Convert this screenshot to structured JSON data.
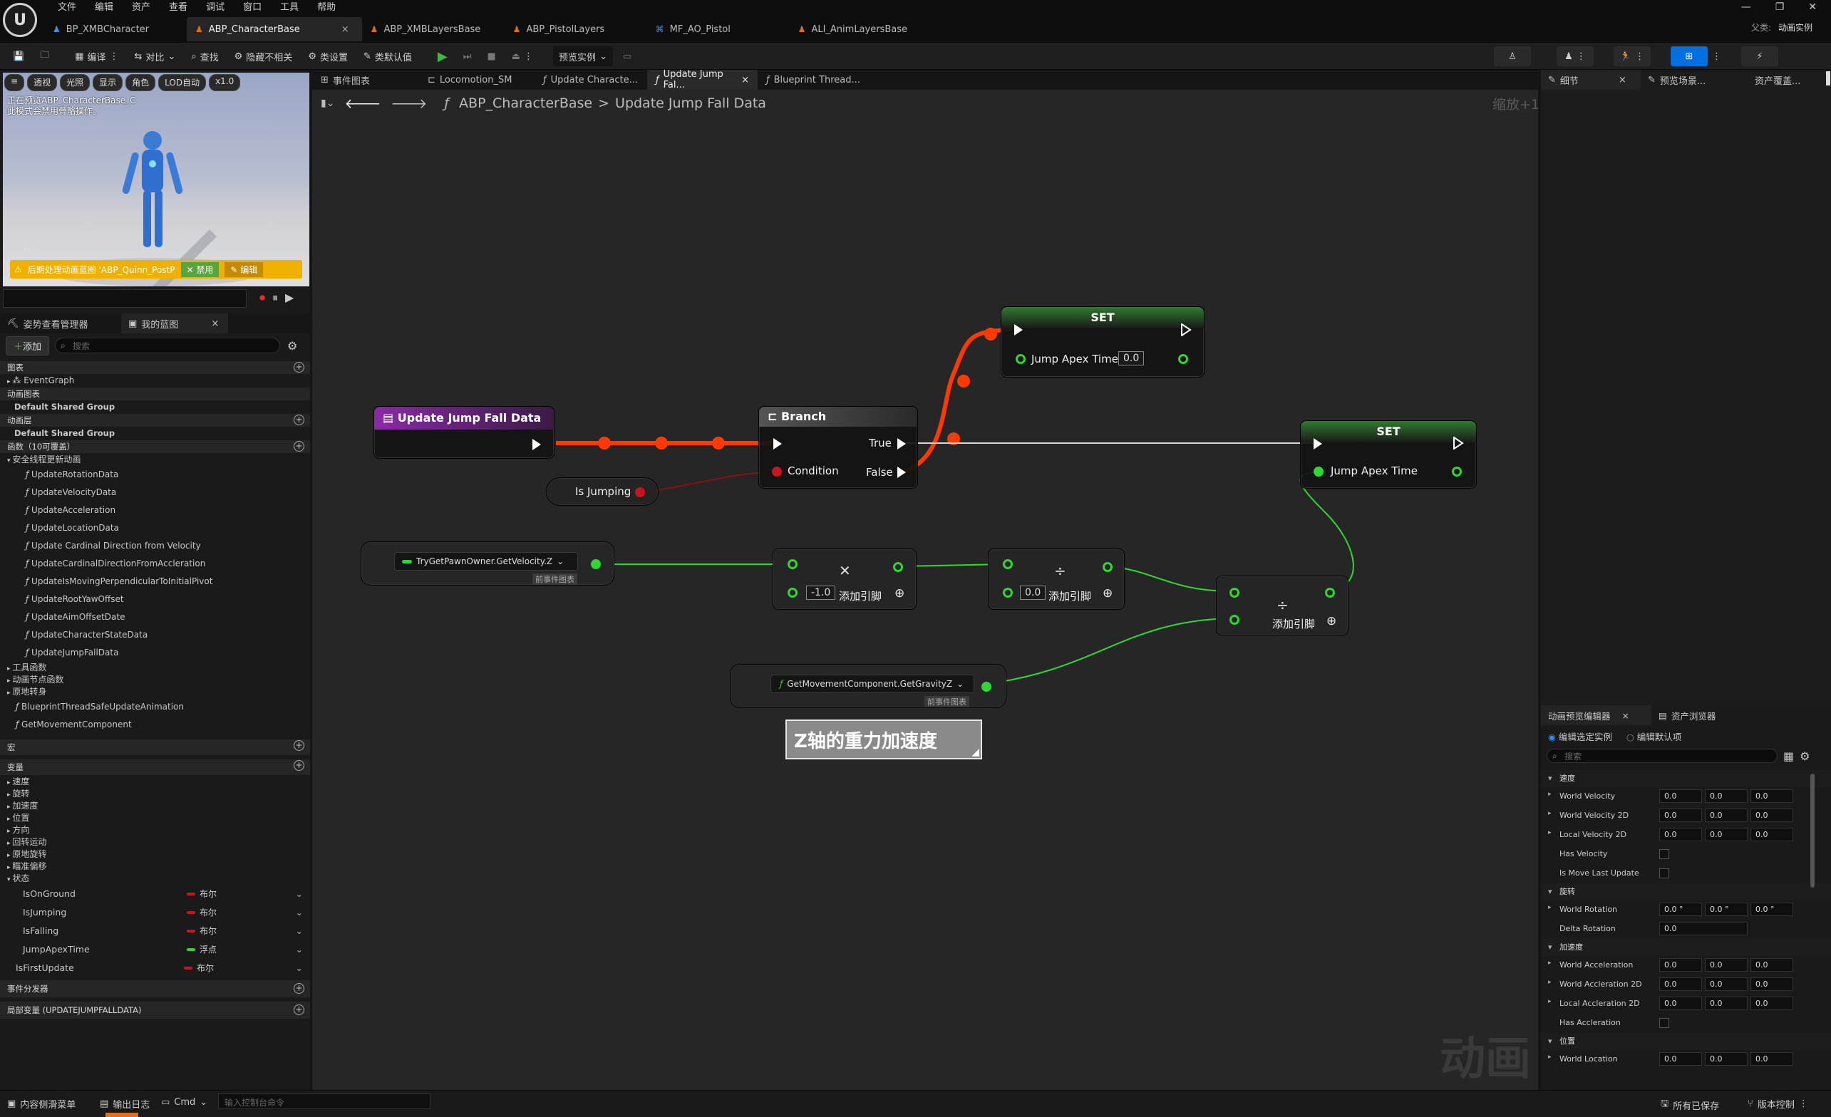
{
  "menu": [
    "文件",
    "编辑",
    "资产",
    "查看",
    "调试",
    "窗口",
    "工具",
    "帮助"
  ],
  "tabs": [
    {
      "label": "BP_XMBCharacter",
      "active": false
    },
    {
      "label": "ABP_CharacterBase",
      "active": true
    },
    {
      "label": "ABP_XMBLayersBase",
      "active": false
    },
    {
      "label": "ABP_PistolLayers",
      "active": false
    },
    {
      "label": "MF_AO_Pistol",
      "active": false
    },
    {
      "label": "ALI_AnimLayersBase",
      "active": false
    }
  ],
  "parent": {
    "label": "父类:",
    "value": "动画实例"
  },
  "toolbar": {
    "compile": "编译",
    "diff": "对比",
    "find": "查找",
    "hide": "隐藏不相关",
    "class_settings": "类设置",
    "class_defaults": "类默认值",
    "preview": "预览实例"
  },
  "viewport": {
    "buttons": [
      "透视",
      "光照",
      "显示",
      "角色",
      "LOD自动",
      "x1.0"
    ],
    "info_line1": "正在预览ABP_CharacterBase_C",
    "info_line2": "此模式会禁用骨骼操作。",
    "warning": "后期处理动画蓝图 'ABP_Quinn_PostP",
    "warn_disable": "禁用",
    "warn_edit": "编辑"
  },
  "left_tabs": {
    "skeleton": "姿势查看管理器",
    "myblueprint": "我的蓝图"
  },
  "add_label": "添加",
  "search_placeholder": "搜索",
  "tree": {
    "graphs": "图表",
    "event_graph": "EventGraph",
    "anim_graphs": "动画图表",
    "default_shared1": "Default Shared Group",
    "anim_layers": "动画层",
    "default_shared2": "Default Shared Group",
    "functions": "函数（10可覆盖）",
    "thread_safe": "安全线程更新动画",
    "function_items": [
      "UpdateRotationData",
      "UpdateVelocityData",
      "UpdateAcceleration",
      "UpdateLocationData",
      "Update Cardinal Direction from Velocity",
      "UpdateCardinalDirectionFromAccleration",
      "UpdateIsMovingPerpendicularToInitialPivot",
      "UpdateRootYawOffset",
      "UpdateAimOffsetDate",
      "UpdateCharacterStateData",
      "UpdateJumpFallData"
    ],
    "tool_funcs": "工具函数",
    "anim_node_funcs": "动画节点函数",
    "turn_in_place": "原地转身",
    "bp_thread": "BlueprintThreadSafeUpdateAnimation",
    "get_move": "GetMovementComponent",
    "macros": "宏",
    "variables": "变量",
    "var_groups": [
      "速度",
      "旋转",
      "加速度",
      "位置",
      "方向",
      "回转运动",
      "原地旋转",
      "瞄准偏移",
      "状态"
    ],
    "state_vars": [
      {
        "name": "IsOnGround",
        "type": "布尔",
        "color": "#c8141e"
      },
      {
        "name": "IsJumping",
        "type": "布尔",
        "color": "#c8141e"
      },
      {
        "name": "IsFalling",
        "type": "布尔",
        "color": "#c8141e"
      },
      {
        "name": "JumpApexTime",
        "type": "浮点",
        "color": "#2fd82f"
      }
    ],
    "first_update": {
      "name": "IsFirstUpdate",
      "type": "布尔",
      "color": "#c8141e"
    },
    "dispatchers": "事件分发器",
    "locals": "局部变量 (UPDATEJUMPFALLDATA)"
  },
  "graph_tabs": [
    {
      "label": "事件图表",
      "active": false
    },
    {
      "label": "Locomotion_SM",
      "active": false
    },
    {
      "label": "Update Characte...",
      "active": false
    },
    {
      "label": "Update Jump Fal...",
      "active": true
    },
    {
      "label": "Blueprint Thread...",
      "active": false
    }
  ],
  "breadcrumb": {
    "root": "ABP_CharacterBase",
    "sep": ">",
    "leaf": "Update Jump Fall Data"
  },
  "zoom": "缩放+1",
  "watermark": "动画",
  "nodes": {
    "entry": "Update Jump Fall Data",
    "branch": "Branch",
    "true": "True",
    "false": "False",
    "condition": "Condition",
    "isjumping": "Is Jumping",
    "set1": "SET",
    "set1_pin": "Jump Apex Time",
    "set1_val": "0.0",
    "set2": "SET",
    "set2_pin": "Jump Apex Time",
    "velocity": "TryGetPawnOwner.GetVelocity.Z",
    "velocity_tag": "前事件图表",
    "gravity": "GetMovementComponent.GetGravityZ",
    "gravity_tag": "前事件图表",
    "mul_val": "-1.0",
    "mul_add": "添加引脚",
    "div1_val": "0.0",
    "div1_add": "添加引脚",
    "div2_add": "添加引脚",
    "comment": "Z轴的重力加速度"
  },
  "right_tabs": {
    "details": "细节",
    "preview": "预览场景...",
    "asset": "资产覆盖..."
  },
  "anim_preview": {
    "tab1": "动画预览编辑器",
    "tab2": "资产浏览器",
    "radio1": "编辑选定实例",
    "radio2": "编辑默认项",
    "search": "搜索",
    "cat_velocity": "速度",
    "cat_rotation": "旋转",
    "cat_accel": "加速度",
    "cat_location": "位置",
    "props": {
      "world_velocity": {
        "name": "World Velocity",
        "vals": [
          "0.0",
          "0.0",
          "0.0"
        ]
      },
      "world_velocity_2d": {
        "name": "World Velocity 2D",
        "vals": [
          "0.0",
          "0.0",
          "0.0"
        ]
      },
      "local_velocity_2d": {
        "name": "Local Velocity 2D",
        "vals": [
          "0.0",
          "0.0",
          "0.0"
        ]
      },
      "has_velocity": "Has Velocity",
      "is_move_last": "Is Move Last Update",
      "world_rotation": {
        "name": "World Rotation",
        "vals": [
          "0.0 °",
          "0.0 °",
          "0.0 °"
        ]
      },
      "delta_rotation": {
        "name": "Delta Rotation",
        "vals": [
          "0.0"
        ]
      },
      "world_accel": {
        "name": "World Acceleration",
        "vals": [
          "0.0",
          "0.0",
          "0.0"
        ]
      },
      "world_accel_2d": {
        "name": "World Accleration 2D",
        "vals": [
          "0.0",
          "0.0",
          "0.0"
        ]
      },
      "local_accel_2d": {
        "name": "Local Accleration 2D",
        "vals": [
          "0.0",
          "0.0",
          "0.0"
        ]
      },
      "has_accel": "Has Accleration",
      "world_location": {
        "name": "World Location",
        "vals": [
          "0.0",
          "0.0",
          "0.0"
        ]
      }
    }
  },
  "status": {
    "drawer": "内容侧滑菜单",
    "log": "输出日志",
    "cmd": "Cmd",
    "cmd_placeholder": "输入控制台命令",
    "saved": "所有已保存",
    "source": "版本控制"
  },
  "colors": {
    "exec_active": "#ff3a00",
    "float_wire": "#2fd82f",
    "bool_wire": "#8a1010",
    "set_header": "#2a6a2a",
    "entry_header": "#7a2a9a",
    "accent": "#0070e0"
  }
}
